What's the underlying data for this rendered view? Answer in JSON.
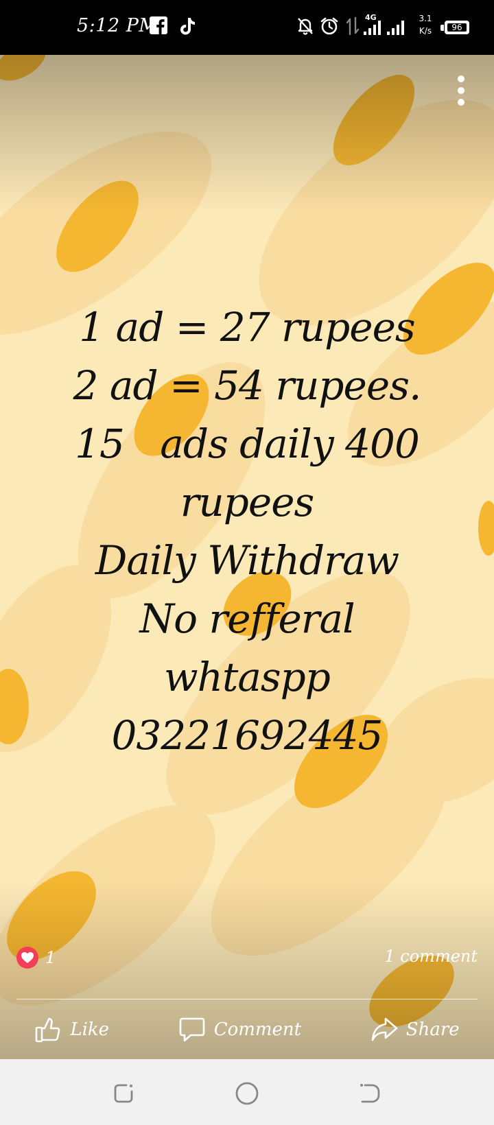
{
  "status_bar": {
    "time": "5:12 PM",
    "network_type": "4G",
    "speed_value": "3.1",
    "speed_unit": "K/s",
    "battery": "96",
    "icons": [
      "facebook-icon",
      "tiktok-icon",
      "bell-off-icon",
      "alarm-icon",
      "data-transfer-icon",
      "signal-icon"
    ]
  },
  "story": {
    "lines": [
      "1 ad = 27 rupees",
      "2 ad = 54 rupees.",
      "15   ads daily 400",
      "rupees",
      "Daily Withdraw",
      "No refferal",
      "whtaspp",
      "03221692445"
    ],
    "colors": {
      "background": "#fce9b8",
      "blob_light": "#f9dca0",
      "blob_accent": "#f5b731",
      "text": "#111111"
    }
  },
  "reactions": {
    "count": "1",
    "comments": "1 comment"
  },
  "actions": {
    "like": "Like",
    "comment": "Comment",
    "share": "Share"
  },
  "accent": {
    "heart": "#f33e58"
  }
}
